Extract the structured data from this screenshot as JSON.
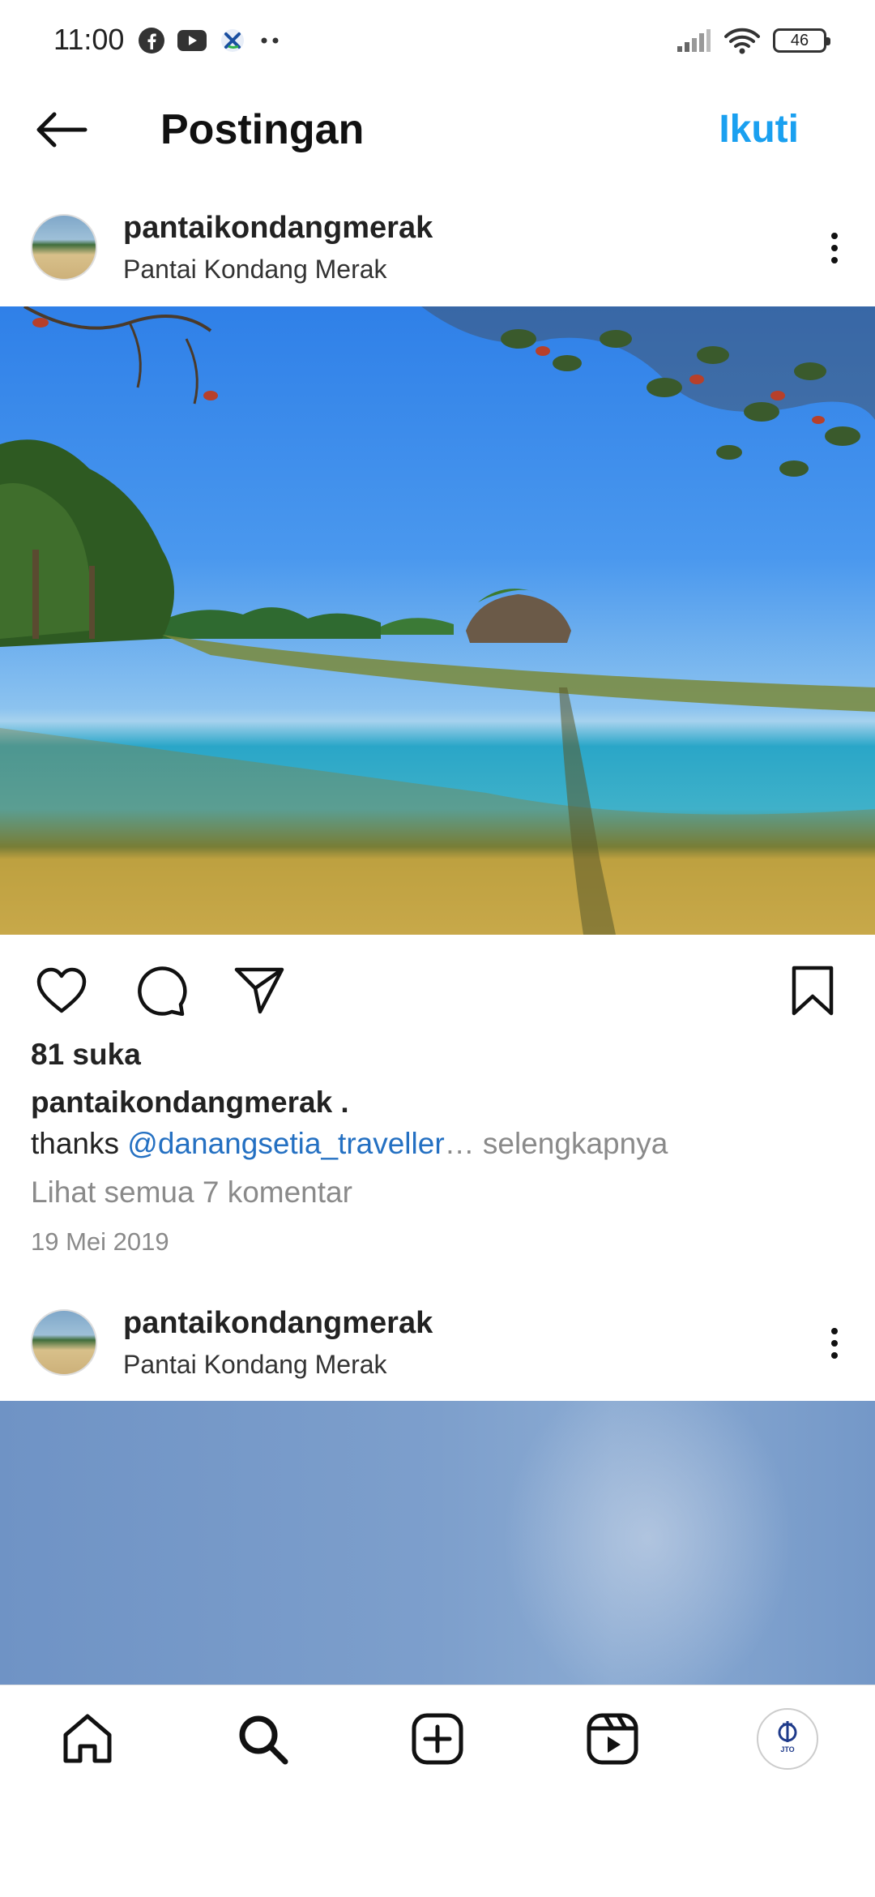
{
  "status_bar": {
    "time": "11:00",
    "battery": "46",
    "left_icons": [
      "facebook-icon",
      "youtube-icon",
      "carrier-icon",
      "more-dots-icon"
    ],
    "right_icons": [
      "signal-icon",
      "wifi-icon",
      "battery-icon"
    ]
  },
  "header": {
    "title": "Postingan",
    "follow_label": "Ikuti",
    "accent_color": "#1aa0f0"
  },
  "posts": [
    {
      "username": "pantaikondangmerak",
      "location": "Pantai Kondang Merak",
      "likes": "81 suka",
      "caption_user": "pantaikondangmerak .",
      "caption_prefix": "thanks ",
      "caption_mention": "@danangsetia_traveller",
      "caption_more": "… selengkapnya",
      "comments_link": "Lihat semua 7 komentar",
      "date": "19 Mei 2019"
    },
    {
      "username": "pantaikondangmerak",
      "location": "Pantai Kondang Merak"
    }
  ],
  "actions": [
    "heart-icon",
    "comment-icon",
    "share-icon",
    "bookmark-icon"
  ],
  "bottom_nav": [
    "home-icon",
    "search-icon",
    "add-post-icon",
    "reels-icon",
    "profile-avatar"
  ],
  "profile_avatar_text": "JTO"
}
